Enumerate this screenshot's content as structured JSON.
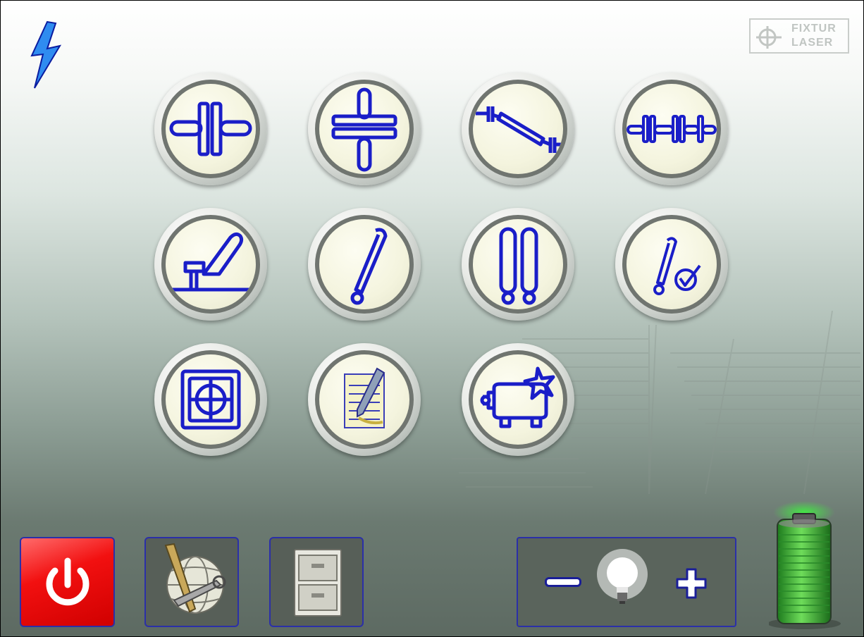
{
  "brand": {
    "line1": "FIXTUR",
    "line2": "LASER"
  },
  "status": {
    "connection_icon": "lightning-bolt-icon",
    "battery_level": 1.0,
    "battery_color": "#3fb23a"
  },
  "colors": {
    "icon_blue": "#1a1ec8",
    "power_red": "#e81010",
    "panel_border": "#2b2fa8"
  },
  "apps": [
    {
      "id": "horizontal-shafts",
      "icon": "horizontal-coupling-icon"
    },
    {
      "id": "vertical-shafts",
      "icon": "vertical-coupling-icon"
    },
    {
      "id": "cardan-shafts",
      "icon": "cardan-shaft-icon"
    },
    {
      "id": "machine-train",
      "icon": "machine-train-icon"
    },
    {
      "id": "flatness",
      "icon": "flatness-measurement-icon"
    },
    {
      "id": "straightness",
      "icon": "straightness-icon"
    },
    {
      "id": "twist",
      "icon": "twist-measurement-icon"
    },
    {
      "id": "values",
      "icon": "values-check-icon"
    },
    {
      "id": "target",
      "icon": "target-icon"
    },
    {
      "id": "notes",
      "icon": "notes-pencil-icon"
    },
    {
      "id": "softfoot",
      "icon": "softfoot-icon"
    }
  ],
  "bottom_bar": {
    "power": "power-icon",
    "settings": "tools-globe-icon",
    "files": "file-cabinet-icon",
    "brightness": {
      "decrease": "minus-icon",
      "bulb": "light-bulb-icon",
      "increase": "plus-icon"
    }
  }
}
